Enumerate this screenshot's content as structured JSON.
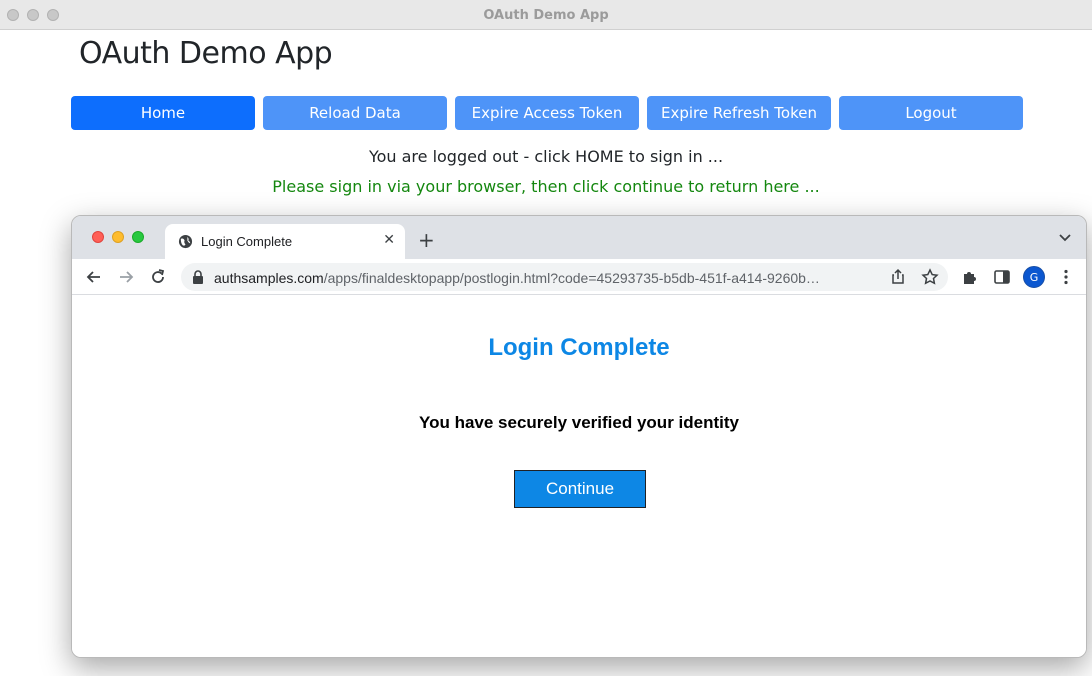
{
  "app": {
    "window_title": "OAuth Demo App",
    "heading": "OAuth Demo App",
    "buttons": [
      {
        "label": "Home",
        "color": "#0d6efd"
      },
      {
        "label": "Reload Data",
        "color": "#4e94f8"
      },
      {
        "label": "Expire Access Token",
        "color": "#4e94f8"
      },
      {
        "label": "Expire Refresh Token",
        "color": "#4e94f8"
      },
      {
        "label": "Logout",
        "color": "#4e94f8"
      }
    ],
    "status_message": "You are logged out - click HOME to sign in ...",
    "info_message": "Please sign in via your browser, then click continue to return here ..."
  },
  "browser": {
    "tab": {
      "title": "Login Complete",
      "icon": "globe-icon"
    },
    "url_host": "authsamples.com",
    "url_path": "/apps/finaldesktopapp/postlogin.html?code=45293735-b5db-451f-a414-9260b…",
    "profile_initial": "G",
    "page": {
      "title": "Login Complete",
      "message": "You have securely verified your identity",
      "continue_label": "Continue"
    }
  }
}
